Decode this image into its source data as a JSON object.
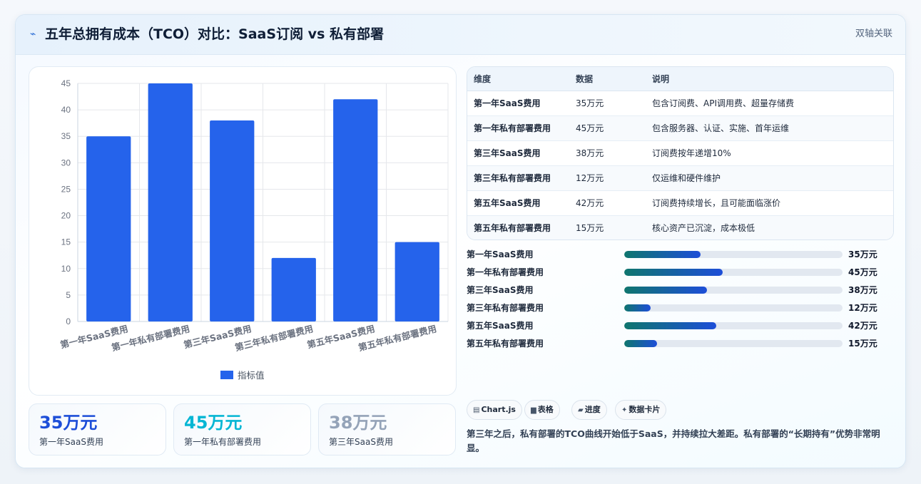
{
  "header": {
    "icon": "trend-icon",
    "title": "五年总拥有成本（TCO）对比：SaaS订阅 vs 私有部署",
    "tag": "双轴关联"
  },
  "chart_data": {
    "type": "bar",
    "categories": [
      "第一年SaaS费用",
      "第一年私有部署费用",
      "第三年SaaS费用",
      "第三年私有部署费用",
      "第五年SaaS费用",
      "第五年私有部署费用"
    ],
    "series": [
      {
        "name": "指标值",
        "values": [
          35,
          45,
          38,
          12,
          42,
          15
        ],
        "color": "#2563eb"
      }
    ],
    "ylim": [
      0,
      45
    ],
    "yticks": [
      0,
      5,
      10,
      15,
      20,
      25,
      30,
      35,
      40,
      45
    ],
    "grid": true,
    "legend": "bottom"
  },
  "stats": [
    {
      "value": "35万元",
      "label": "第一年SaaS费用",
      "color": "#1d4ed8"
    },
    {
      "value": "45万元",
      "label": "第一年私有部署费用",
      "color": "#06b6d4"
    },
    {
      "value": "38万元",
      "label": "第三年SaaS费用",
      "color": "#94a3b8"
    }
  ],
  "table": {
    "headers": [
      "维度",
      "数据",
      "说明"
    ],
    "rows": [
      [
        "第一年SaaS费用",
        "35万元",
        "包含订阅费、API调用费、超量存储费"
      ],
      [
        "第一年私有部署费用",
        "45万元",
        "包含服务器、认证、实施、首年运维"
      ],
      [
        "第三年SaaS费用",
        "38万元",
        "订阅费按年递增10%"
      ],
      [
        "第三年私有部署费用",
        "12万元",
        "仅运维和硬件维护"
      ],
      [
        "第五年SaaS费用",
        "42万元",
        "订阅费持续增长，且可能面临涨价"
      ],
      [
        "第五年私有部署费用",
        "15万元",
        "核心资产已沉淀，成本极低"
      ]
    ]
  },
  "progress": {
    "max": 100,
    "items": [
      {
        "label": "第一年SaaS费用",
        "value": 35,
        "text": "35万元"
      },
      {
        "label": "第一年私有部署费用",
        "value": 45,
        "text": "45万元"
      },
      {
        "label": "第三年SaaS费用",
        "value": 38,
        "text": "38万元"
      },
      {
        "label": "第三年私有部署费用",
        "value": 12,
        "text": "12万元"
      },
      {
        "label": "第五年SaaS费用",
        "value": 42,
        "text": "42万元"
      },
      {
        "label": "第五年私有部署费用",
        "value": 15,
        "text": "15万元"
      }
    ]
  },
  "chips": [
    {
      "icon": "▤",
      "icon_name": "chart-icon",
      "label": "Chart.js"
    },
    {
      "icon": "▆",
      "icon_name": "table-icon",
      "label": "表格"
    },
    {
      "icon": "▰",
      "icon_name": "progress-icon",
      "label": "进度"
    },
    {
      "icon": "✦",
      "icon_name": "sparkle-icon",
      "label": "数据卡片"
    }
  ],
  "summary": "第三年之后，私有部署的TCO曲线开始低于SaaS，并持续拉大差距。私有部署的“长期持有”优势非常明显。"
}
